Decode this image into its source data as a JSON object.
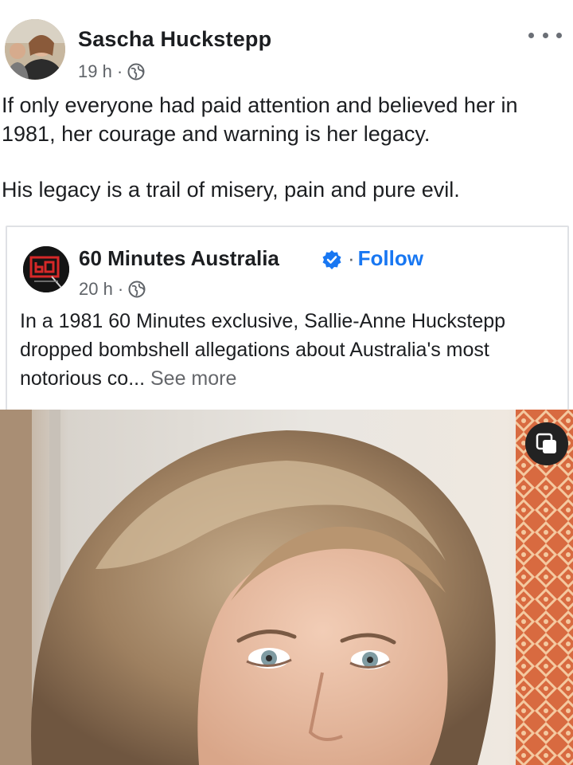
{
  "post": {
    "author": "Sascha Huckstepp",
    "time": "19 h",
    "separator": "·",
    "paragraphs": [
      "If only everyone had paid attention and believed her in 1981, her courage and warning is her legacy.",
      "His legacy is a trail of misery, pain and pure evil."
    ]
  },
  "shared": {
    "page_name": "60 Minutes Australia",
    "separator": "·",
    "follow_label": "Follow",
    "time": "20 h",
    "text": "In a 1981 60 Minutes exclusive, Sallie-Anne Huckstepp dropped bombshell allegations about Australia's most notorious co...",
    "see_more": "See more"
  },
  "colors": {
    "link_blue": "#1877f2",
    "muted_text": "#65676b",
    "verified_badge": "#1877f2"
  },
  "icons": {
    "more": "more-dots-icon",
    "privacy": "globe-icon",
    "verified": "verified-badge-icon",
    "pip": "picture-in-picture-icon"
  }
}
